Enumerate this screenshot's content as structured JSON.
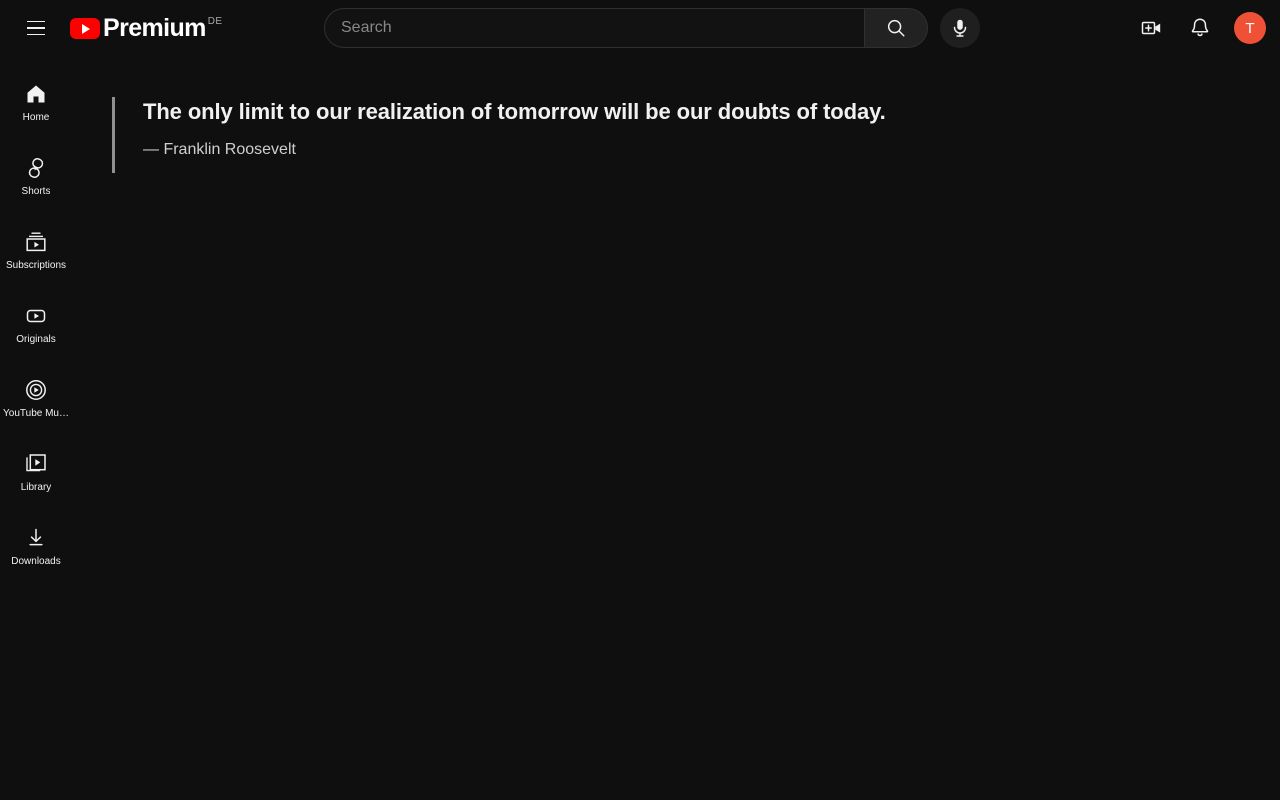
{
  "header": {
    "menu_icon": "hamburger-menu-icon",
    "logo": {
      "play_icon": "youtube-play-icon",
      "text": "Premium",
      "country_code": "DE"
    },
    "search": {
      "placeholder": "Search",
      "value": "",
      "search_icon": "search-icon",
      "mic_icon": "microphone-icon"
    },
    "actions": [
      {
        "name": "create-video-icon",
        "label": "Create"
      },
      {
        "name": "notifications-bell-icon",
        "label": "Notifications"
      }
    ],
    "avatar": {
      "initial": "T",
      "color": "#ef5136"
    }
  },
  "sidebar": {
    "items": [
      {
        "label": "Home",
        "icon": "home-icon",
        "active": true
      },
      {
        "label": "Shorts",
        "icon": "shorts-icon",
        "active": false
      },
      {
        "label": "Subscriptions",
        "icon": "subscriptions-icon",
        "active": false
      },
      {
        "label": "Originals",
        "icon": "originals-icon",
        "active": false
      },
      {
        "label": "YouTube Mu…",
        "icon": "youtube-music-icon",
        "active": false
      },
      {
        "label": "Library",
        "icon": "library-icon",
        "active": false
      },
      {
        "label": "Downloads",
        "icon": "downloads-icon",
        "active": false
      }
    ]
  },
  "main": {
    "quote": {
      "text": "The only limit to our realization of tomorrow will be our doubts of today.",
      "author": "— Franklin Roosevelt"
    }
  },
  "colors": {
    "background": "#0f0f0f",
    "brand_red": "#ff0000",
    "text_primary": "#f1f1f1",
    "text_secondary": "#aaaaaa",
    "accent_bar": "#909090",
    "avatar": "#ef5136"
  }
}
